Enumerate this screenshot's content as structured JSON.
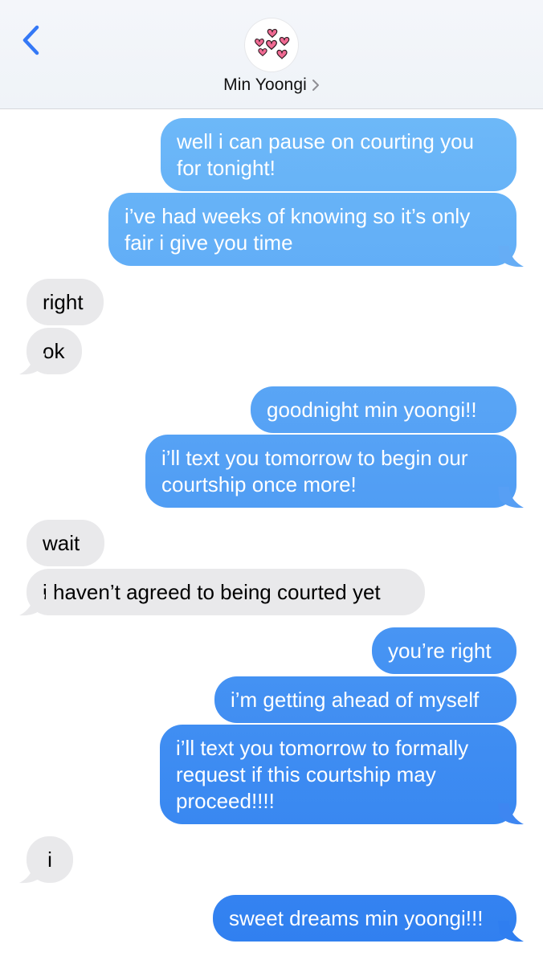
{
  "header": {
    "back_label": "back",
    "contact_name": "Min Yoongi",
    "avatar_icon": "hearts-icon",
    "accent_color": "#3478f6"
  },
  "colors": {
    "sent_top": "#6db8f8",
    "sent_bottom": "#2f7ef0",
    "received": "#e9e9eb"
  },
  "messages": [
    {
      "side": "sent",
      "text": "well i can pause on courting you for tonight!"
    },
    {
      "side": "sent",
      "text": "i’ve had weeks of knowing so it’s only fair i give you time"
    },
    {
      "side": "received",
      "text": "right"
    },
    {
      "side": "received",
      "text": "ok"
    },
    {
      "side": "sent",
      "text": "goodnight min yoongi!!"
    },
    {
      "side": "sent",
      "text": "i’ll text you tomorrow to begin our courtship once more!"
    },
    {
      "side": "received",
      "text": "wait"
    },
    {
      "side": "received",
      "text": "i haven’t agreed to being courted yet"
    },
    {
      "side": "sent",
      "text": "you’re right"
    },
    {
      "side": "sent",
      "text": "i’m getting ahead of myself"
    },
    {
      "side": "sent",
      "text": "i’ll text you tomorrow to formally request if this courtship may proceed!!!!"
    },
    {
      "side": "received",
      "text": "i"
    },
    {
      "side": "sent",
      "text": "sweet dreams min yoongi!!!"
    }
  ]
}
